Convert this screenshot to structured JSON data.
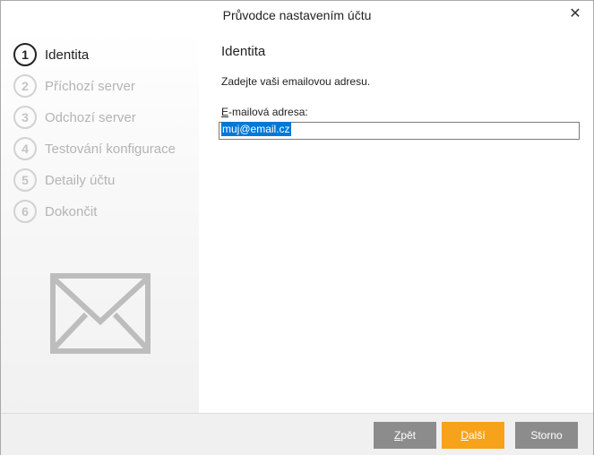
{
  "window": {
    "title": "Průvodce nastavením účtu"
  },
  "steps": [
    {
      "num": "1",
      "label": "Identita",
      "active": true
    },
    {
      "num": "2",
      "label": "Příchozí server",
      "active": false
    },
    {
      "num": "3",
      "label": "Odchozí server",
      "active": false
    },
    {
      "num": "4",
      "label": "Testování konfigurace",
      "active": false
    },
    {
      "num": "5",
      "label": "Detaily účtu",
      "active": false
    },
    {
      "num": "6",
      "label": "Dokončit",
      "active": false
    }
  ],
  "main": {
    "heading": "Identita",
    "prompt": "Zadejte vaši emailovou adresu.",
    "email_label_mnemonic": "E",
    "email_label_rest": "-mailová adresa:",
    "email_value": "muj@email.cz"
  },
  "buttons": {
    "back": {
      "mnemonic": "Z",
      "rest": "pět"
    },
    "next": {
      "mnemonic": "D",
      "rest": "alší"
    },
    "cancel": "Storno"
  },
  "colors": {
    "accent": "#f7a21b",
    "button_gray": "#8c8c8c",
    "selection": "#0078d7"
  },
  "icons": {
    "close": "close-icon",
    "sidebar": "envelope-icon"
  }
}
